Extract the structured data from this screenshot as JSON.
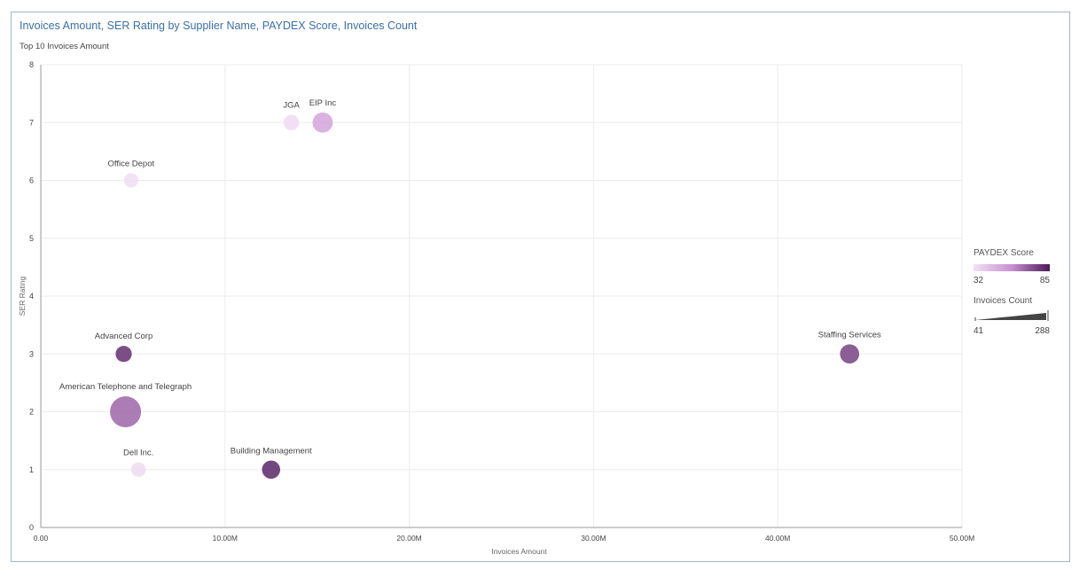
{
  "title": "Invoices Amount, SER Rating by Supplier Name, PAYDEX Score, Invoices Count",
  "subtitle": "Top 10 Invoices Amount",
  "legend": {
    "color_title": "PAYDEX Score",
    "color_min": "32",
    "color_max": "85",
    "size_title": "Invoices Count",
    "size_min": "41",
    "size_max": "288"
  },
  "colors": {
    "low": "#f1e1f3",
    "mid": "#c98fd3",
    "high": "#4d1a5a",
    "title": "#3a6fa8",
    "frame": "#9fb8cc"
  },
  "chart_data": {
    "type": "scatter",
    "title": "Invoices Amount, SER Rating by Supplier Name, PAYDEX Score, Invoices Count",
    "subtitle": "Top 10 Invoices Amount",
    "xlabel": "Invoices Amount",
    "ylabel": "SER Rating",
    "xlim": [
      0,
      50000000
    ],
    "ylim": [
      0,
      8
    ],
    "xticks": [
      0,
      10000000,
      20000000,
      30000000,
      40000000,
      50000000
    ],
    "xtick_labels": [
      "0.00",
      "10.00M",
      "20.00M",
      "30.00M",
      "40.00M",
      "50.00M"
    ],
    "yticks": [
      0,
      1,
      2,
      3,
      4,
      5,
      6,
      7,
      8
    ],
    "ytick_labels": [
      "0",
      "1",
      "2",
      "3",
      "4",
      "5",
      "6",
      "7",
      "8"
    ],
    "grid": true,
    "legend_position": "right",
    "points": [
      {
        "name": "JGA",
        "x": 13600000,
        "y": 7,
        "paydex": 34,
        "count": 60
      },
      {
        "name": "EIP Inc",
        "x": 15300000,
        "y": 7,
        "paydex": 52,
        "count": 130
      },
      {
        "name": "Office Depot",
        "x": 4900000,
        "y": 6,
        "paydex": 33,
        "count": 45
      },
      {
        "name": "Advanced Corp",
        "x": 4500000,
        "y": 3,
        "paydex": 80,
        "count": 70
      },
      {
        "name": "American Telephone and Telegraph",
        "x": 4600000,
        "y": 2,
        "paydex": 68,
        "count": 288
      },
      {
        "name": "Dell Inc.",
        "x": 5300000,
        "y": 1,
        "paydex": 34,
        "count": 48
      },
      {
        "name": "Building Management",
        "x": 12500000,
        "y": 1,
        "paydex": 82,
        "count": 100
      },
      {
        "name": "Staffing Services",
        "x": 43900000,
        "y": 3,
        "paydex": 76,
        "count": 115
      }
    ]
  }
}
